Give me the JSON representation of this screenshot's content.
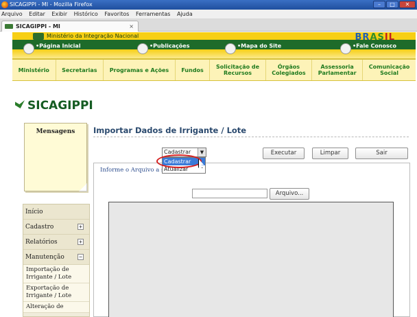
{
  "browser": {
    "window_title": "SICAGIPPI - MI - Mozilla Firefox",
    "menu": [
      "Arquivo",
      "Editar",
      "Exibir",
      "Histórico",
      "Favoritos",
      "Ferramentas",
      "Ajuda"
    ],
    "tab_title": "SICAGIPPI - MI",
    "tab_close": "×"
  },
  "gov_header": {
    "ministry": "Ministério da Integração Nacional",
    "brasil_logo": "BRASIL",
    "links": [
      "Página Inicial",
      "Publicações",
      "Mapa do Site",
      "Fale Conosco"
    ]
  },
  "site_nav": [
    [
      "Ministério"
    ],
    [
      "Secretarias"
    ],
    [
      "Programas e Ações"
    ],
    [
      "Fundos"
    ],
    [
      "Solicitação de",
      "Recursos"
    ],
    [
      "Órgãos",
      "Colegiados"
    ],
    [
      "Assessoria",
      "Parlamentar"
    ],
    [
      "Comunicação",
      "Social"
    ]
  ],
  "site_logo": "SICAGIPPI",
  "messages_title": "Mensagens",
  "sidebar": {
    "items": [
      {
        "label": "Início",
        "expander": ""
      },
      {
        "label": "Cadastro",
        "expander": "+"
      },
      {
        "label": "Relatórios",
        "expander": "+"
      },
      {
        "label": "Manutenção",
        "expander": "−"
      }
    ],
    "subitems": [
      [
        "Importação de",
        "Irrigante / Lote"
      ],
      [
        "Exportação de",
        "Irrigante / Lote"
      ],
      [
        "Alteração de",
        ""
      ]
    ]
  },
  "main": {
    "heading": "Importar Dados de Irrigante / Lote",
    "action_select": {
      "value": "Cadastrar",
      "options": [
        "Cadastrar",
        "Atualizar"
      ],
      "highlighted": "Cadastrar"
    },
    "buttons": {
      "execute": "Executar",
      "clear": "Limpar",
      "exit": "Sair"
    },
    "form_legend": "Informe o Arquivo a ser Importado",
    "file_button": "Arquivo..."
  },
  "colors": {
    "gov_yellow": "#f7cf14",
    "gov_green": "#1e6b2a",
    "nav_text": "#1f7a1f",
    "heading": "#2b4a6e",
    "annotation_circle": "#d52020"
  }
}
